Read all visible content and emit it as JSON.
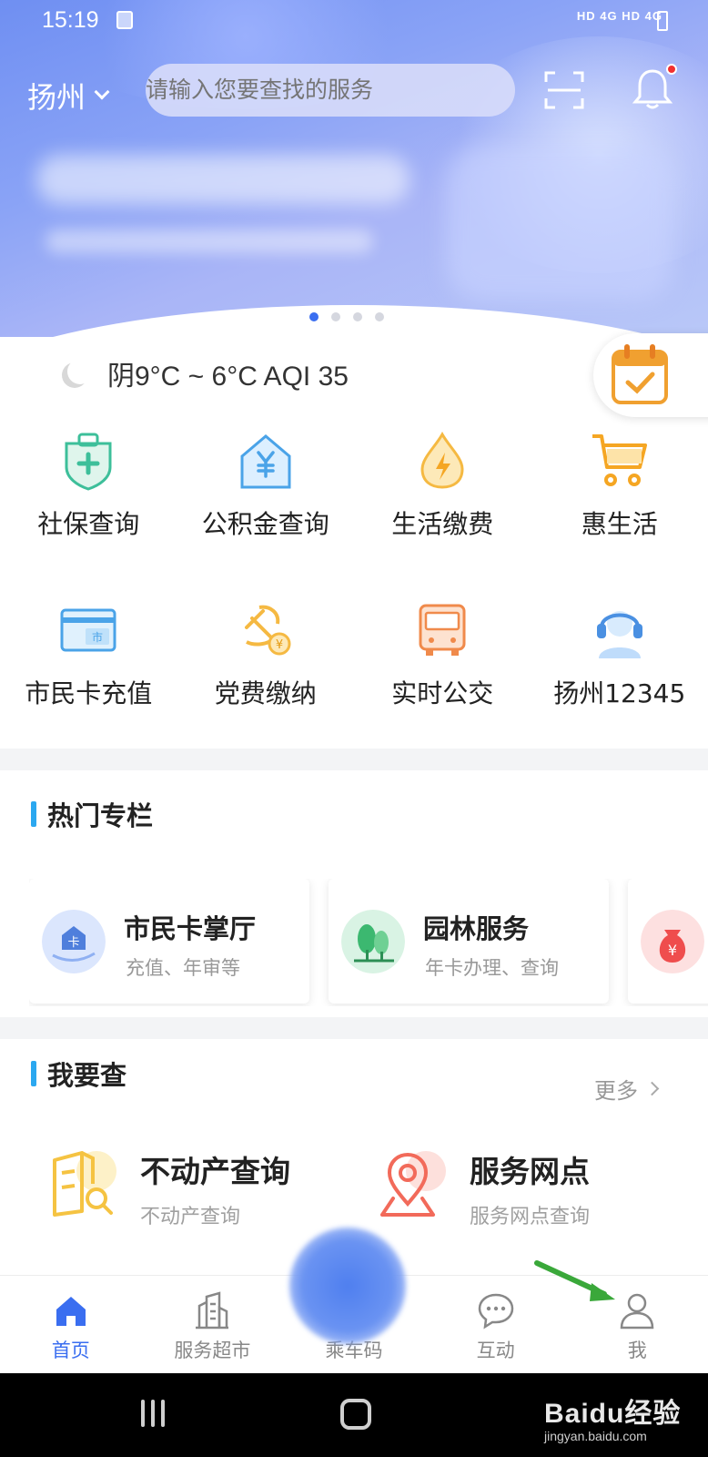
{
  "status_bar": {
    "time": "15:19",
    "signal_text": "HD 4G HD 4G"
  },
  "header": {
    "city": "扬州",
    "search_placeholder": "请输入您要查找的服务",
    "banner_page_count": 4,
    "banner_active_index": 0
  },
  "weather": {
    "text": "阴9°C ~ 6°C AQI 35"
  },
  "services": [
    {
      "label": "社保查询",
      "icon": "medical-shield-icon",
      "color": "#3dbf9a"
    },
    {
      "label": "公积金查询",
      "icon": "house-yuan-icon",
      "color": "#4aa3e8"
    },
    {
      "label": "生活缴费",
      "icon": "water-lightning-icon",
      "color": "#f5b942"
    },
    {
      "label": "惠生活",
      "icon": "shopping-cart-icon",
      "color": "#f5a623"
    },
    {
      "label": "市民卡充值",
      "icon": "citizen-card-icon",
      "color": "#4aa3e8"
    },
    {
      "label": "党费缴纳",
      "icon": "party-emblem-icon",
      "color": "#f5b942"
    },
    {
      "label": "实时公交",
      "icon": "bus-icon",
      "color": "#f08a4b"
    },
    {
      "label": "扬州12345",
      "icon": "headset-icon",
      "color": "#4a90e2"
    }
  ],
  "hot_section": {
    "title": "热门专栏",
    "cards": [
      {
        "title": "市民卡掌厅",
        "subtitle": "充值、年审等",
        "icon": "card-icon"
      },
      {
        "title": "园林服务",
        "subtitle": "年卡办理、查询",
        "icon": "tree-icon"
      },
      {
        "title": "",
        "subtitle": "",
        "icon": "money-bag-icon"
      }
    ]
  },
  "query_section": {
    "title": "我要查",
    "more_label": "更多",
    "items": [
      {
        "title": "不动产查询",
        "subtitle": "不动产查询",
        "icon": "property-search-icon"
      },
      {
        "title": "服务网点",
        "subtitle": "服务网点查询",
        "icon": "location-pin-icon"
      }
    ]
  },
  "bottom_nav": [
    {
      "label": "首页",
      "icon": "home-icon",
      "active": true
    },
    {
      "label": "服务超市",
      "icon": "building-icon",
      "active": false
    },
    {
      "label": "乘车码",
      "icon": "ride-code-icon",
      "active": false
    },
    {
      "label": "互动",
      "icon": "chat-icon",
      "active": false
    },
    {
      "label": "我",
      "icon": "user-icon",
      "active": false
    }
  ],
  "watermark": {
    "line1": "Baidu经验",
    "line2": "jingyan.baidu.com"
  },
  "colors": {
    "accent": "#3a6ef0",
    "section_bar": "#2ba8f0",
    "annotation_arrow": "#3aa83a"
  }
}
